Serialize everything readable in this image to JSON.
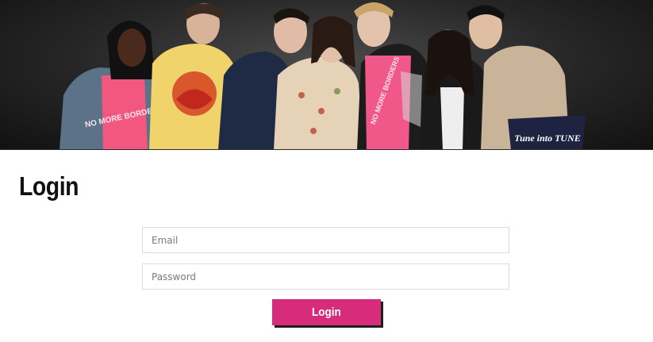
{
  "hero": {
    "shirt_text_1": "NO MORE BORDERS",
    "shirt_text_2": "NO MORE BORDERS",
    "bag_text": "Tune into TUNE"
  },
  "login": {
    "title": "Login",
    "email_placeholder": "Email",
    "password_placeholder": "Password",
    "button_label": "Login"
  },
  "colors": {
    "accent": "#d72c7c",
    "hero_background": "#2b2b2b"
  }
}
